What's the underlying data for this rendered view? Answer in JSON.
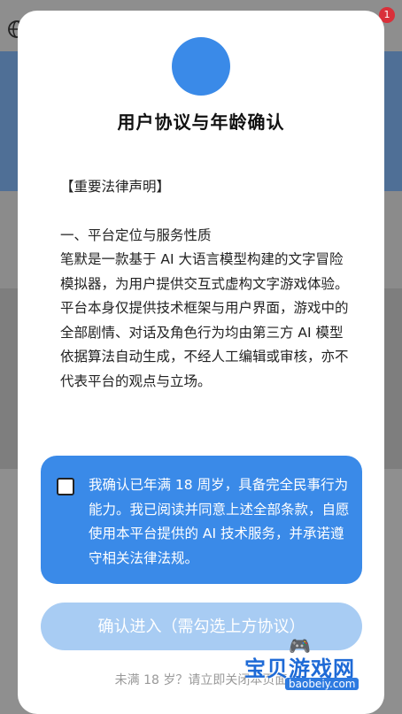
{
  "background": {
    "badge_count": "1"
  },
  "modal": {
    "title": "用户协议与年龄确认",
    "section_heading": "【重要法律声明】",
    "section1_title": "一、平台定位与服务性质",
    "section1_body": "笔默是一款基于 AI 大语言模型构建的文字冒险模拟器，为用户提供交互式虚构文字游戏体验。平台本身仅提供技术框架与用户界面，游戏中的全部剧情、对话及角色行为均由第三方 AI 模型依据算法自动生成，不经人工编辑或审核，亦不代表平台的观点与立场。",
    "agreement_text": "我确认已年满 18 周岁，具备完全民事行为能力。我已阅读并同意上述全部条款，自愿使用本平台提供的 AI 技术服务，并承诺遵守相关法律法规。",
    "agreement_checked": false,
    "confirm_button": "确认进入（需勾选上方协议）",
    "footer_note": "未满 18 岁？请立即关闭本页面"
  },
  "watermark": {
    "text": "宝贝游戏网",
    "url": "baobeiy.com"
  },
  "colors": {
    "accent": "#3a8ae8",
    "button_disabled": "#a8ccf3"
  }
}
